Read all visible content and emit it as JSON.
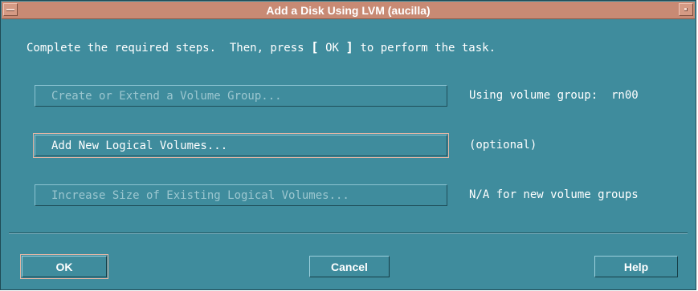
{
  "window": {
    "title": "Add a Disk Using LVM (aucilla)"
  },
  "instruction": {
    "before": "Complete the required steps.  Then, press ",
    "bracket_open": "[",
    "ok_word": " OK ",
    "bracket_close": "]",
    "after": " to perform the task."
  },
  "steps": [
    {
      "label": "Create or Extend a Volume Group...",
      "status": "Using volume group:  rn00",
      "enabled": false
    },
    {
      "label": "Add New Logical Volumes...",
      "status": "(optional)",
      "enabled": true
    },
    {
      "label": "Increase Size of Existing Logical Volumes...",
      "status": "N/A for new volume groups",
      "enabled": false
    }
  ],
  "buttons": {
    "ok": "OK",
    "cancel": "Cancel",
    "help": "Help"
  },
  "colors": {
    "window_bg": "#3f8c9d",
    "titlebar": "#c88a74",
    "disabled_text": "#9cc7d0",
    "text": "#ffffff"
  },
  "icons": {
    "window_menu": "window-menu-icon",
    "maximize": "maximize-icon"
  }
}
